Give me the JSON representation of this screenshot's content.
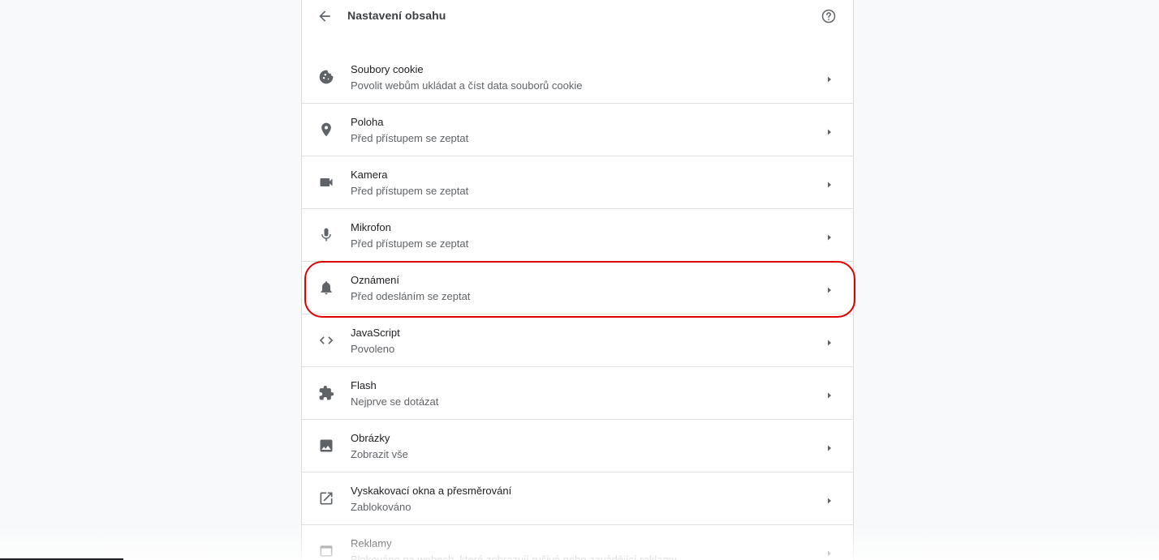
{
  "header": {
    "title": "Nastavení obsahu"
  },
  "settings": {
    "items": [
      {
        "title": "Soubory cookie",
        "subtitle": "Povolit webům ukládat a číst data souborů cookie",
        "icon": "cookie-icon"
      },
      {
        "title": "Poloha",
        "subtitle": "Před přístupem se zeptat",
        "icon": "location-pin-icon"
      },
      {
        "title": "Kamera",
        "subtitle": "Před přístupem se zeptat",
        "icon": "camera-icon"
      },
      {
        "title": "Mikrofon",
        "subtitle": "Před přístupem se zeptat",
        "icon": "microphone-icon"
      },
      {
        "title": "Oznámení",
        "subtitle": "Před odesláním se zeptat",
        "icon": "bell-icon"
      },
      {
        "title": "JavaScript",
        "subtitle": "Povoleno",
        "icon": "code-icon"
      },
      {
        "title": "Flash",
        "subtitle": "Nejprve se dotázat",
        "icon": "puzzle-icon"
      },
      {
        "title": "Obrázky",
        "subtitle": "Zobrazit vše",
        "icon": "image-icon"
      },
      {
        "title": "Vyskakovací okna a přesměrování",
        "subtitle": "Zablokováno",
        "icon": "open-in-new-icon"
      },
      {
        "title": "Reklamy",
        "subtitle": "Blokováno na webech, které zobrazují rušivé nebo zavádějící reklamy",
        "icon": "window-icon"
      }
    ]
  },
  "colors": {
    "highlight": "#e00000",
    "icon": "#5f6368"
  }
}
